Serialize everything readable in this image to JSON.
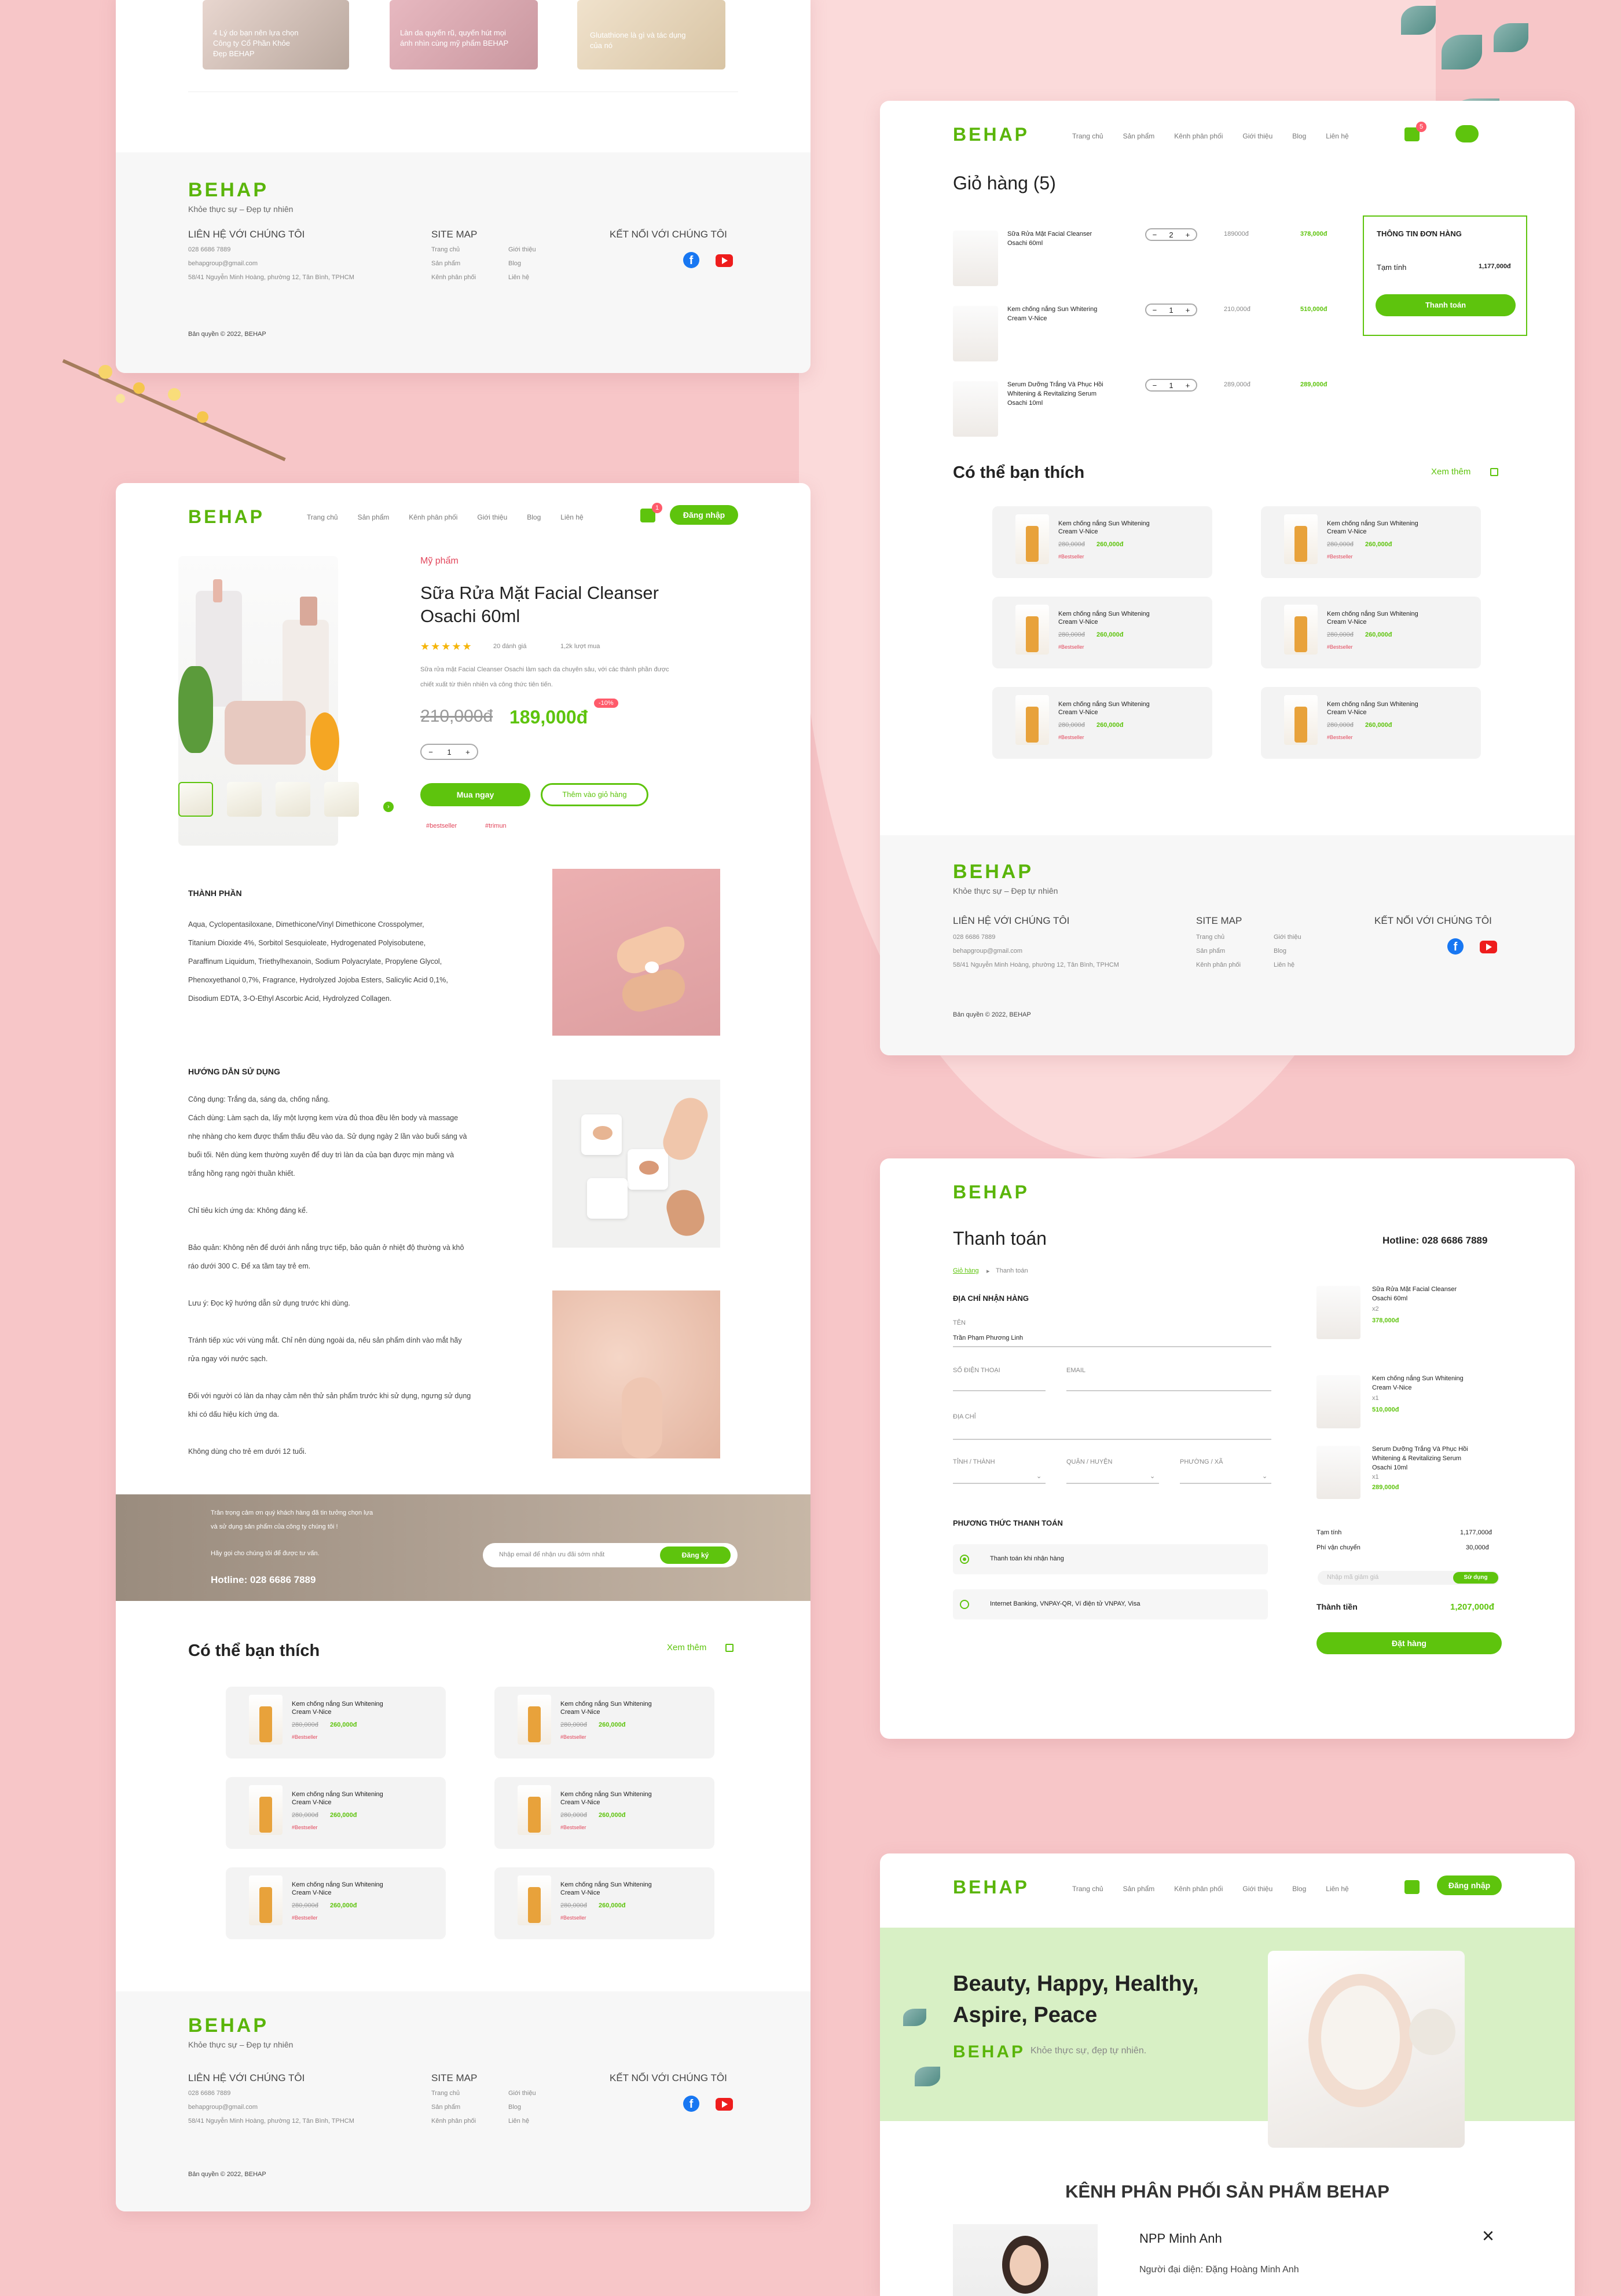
{
  "brand": {
    "logo": "BEHAP",
    "tagline": "Khỏe thực sự – Đẹp tự nhiên",
    "accent": "#5ec40d",
    "pink_bg": "#f7c6c8"
  },
  "nav": [
    "Trang chủ",
    "Sản phẩm",
    "Kênh phân phối",
    "Giới thiệu",
    "Blog",
    "Liên hệ"
  ],
  "login_label": "Đăng nhập",
  "cart_count": "1",
  "cart_count_cart": "5",
  "blog_cards": [
    {
      "title": "4 Lý do bạn nên lựa chọn Công ty Cổ Phần Khỏe Đẹp BEHAP"
    },
    {
      "title": "Làn da quyến rũ, quyến hút mọi ánh nhìn cùng mỹ phẩm BEHAP"
    },
    {
      "title": "Glutathione là gì và tác dụng của nó"
    }
  ],
  "footer": {
    "contact_title": "LIÊN HỆ VỚI CHÚNG TÔI",
    "phone": "028 6686 7889",
    "email": "behapgroup@gmail.com",
    "address": "58/41 Nguyễn Minh Hoàng, phường 12, Tân Bình, TPHCM",
    "sitemap_title": "SITE MAP",
    "sitemap_col1": [
      "Trang chủ",
      "Sản phẩm",
      "Kênh phân phối"
    ],
    "sitemap_col2": [
      "Giới thiệu",
      "Blog",
      "Liên hệ"
    ],
    "social_title": "KẾT NỐI VỚI CHÚNG TÔI",
    "copyright": "Bản quyền © 2022, BEHAP"
  },
  "product": {
    "category": "Mỹ phẩm",
    "name_line1": "Sữa Rửa Mặt Facial Cleanser",
    "name_line2": "Osachi 60ml",
    "rating": 4.5,
    "reviews": "20 đánh giá",
    "sold": "1,2k lượt mua",
    "desc_line1": "Sữa rửa mặt Facial Cleanser Osachi làm sạch da chuyên sâu, với các thành phần được",
    "desc_line2": "chiết xuất từ thiên nhiên và công thức tiên tiến.",
    "old_price": "210,000đ",
    "price": "189,000đ",
    "discount": "-10%",
    "qty": "1",
    "buy_now": "Mua ngay",
    "add_cart": "Thêm vào giỏ hàng",
    "tags": [
      "#bestseller",
      "#trimun"
    ]
  },
  "ingredients": {
    "title": "THÀNH PHẦN",
    "lines": [
      "Aqua, Cyclopentasiloxane, Dimethicone/Vinyl Dimethicone Crosspolymer,",
      "Titanium Dioxide 4%, Sorbitol Sesquioleate, Hydrogenated Polyisobutene,",
      "Paraffinum Liquidum, Triethylhexanoin, Sodium Polyacrylate, Propylene Glycol,",
      "Phenoxyethanol 0,7%, Fragrance, Hydrolyzed Jojoba Esters, Salicylic Acid 0,1%,",
      "Disodium EDTA, 3-O-Ethyl Ascorbic Acid, Hydrolyzed Collagen."
    ]
  },
  "usage": {
    "title": "HƯỚNG DẪN SỬ DỤNG",
    "lines": [
      "Công dụng: Trắng da, sáng da, chống nắng.",
      "Cách dùng: Làm sạch da, lấy một lượng kem vừa đủ thoa đều lên body và massage",
      "nhẹ nhàng cho kem được thẩm thấu đều vào da. Sử dụng ngày 2 lần vào buổi sáng và",
      "buổi tối. Nên dùng kem thường xuyên để duy trì làn da của bạn được mịn màng và",
      "trắng hồng rạng ngời thuần khiết.",
      "",
      "Chỉ tiêu kích ứng da: Không đáng kể.",
      "",
      "Bảo quản: Không nên để dưới ánh nắng trực tiếp, bảo quản ở nhiệt độ thường và khô",
      "ráo dưới 300 C. Để xa tầm tay trẻ em.",
      "",
      "Lưu ý: Đọc kỹ hướng dẫn sử dụng trước khi dùng.",
      "",
      "Tránh tiếp xúc với vùng mắt. Chỉ nên dùng ngoài da, nếu sản phẩm dính vào mắt hãy",
      "rửa ngay với nước sạch.",
      "",
      "Đối với người có làn da nhạy cảm nên thử sản phẩm trước khi sử dụng, ngưng sử dụng",
      "khi có dấu hiệu kích ứng da.",
      "",
      "Không dùng cho trẻ em dưới 12 tuổi."
    ]
  },
  "newsletter": {
    "line1": "Trân trọng cảm ơn quý khách hàng đã tin tưởng chọn lựa",
    "line2": "và sử dụng sản phẩm của công ty chúng tôi !",
    "line3": "Hãy gọi cho chúng tôi để được tư vấn.",
    "hotline": "Hotline: 028 6686 7889",
    "placeholder": "Nhập email để nhận ưu đãi sớm nhất",
    "submit": "Đăng ký"
  },
  "suggest": {
    "title": "Có thể bạn thích",
    "more": "Xem thêm",
    "item_name1": "Kem chống nắng Sun Whitening",
    "item_name2": "Cream V-Nice",
    "old": "280,000đ",
    "price": "260,000đ",
    "tag": "#Bestseller"
  },
  "cart": {
    "title": "Giỏ hàng (5)",
    "items": [
      {
        "name1": "Sữa Rửa Mặt Facial Cleanser",
        "name2": "Osachi 60ml",
        "name3": "",
        "qty": "2",
        "unit": "189000đ",
        "total": "378,000đ"
      },
      {
        "name1": "Kem chống nắng Sun Whitering",
        "name2": "Cream V-Nice",
        "name3": "",
        "qty": "1",
        "unit": "210,000đ",
        "total": "510,000đ"
      },
      {
        "name1": "Serum Dưỡng Trắng Và Phục Hồi",
        "name2": "Whitening & Revitalizing Serum",
        "name3": "Osachi 10ml",
        "qty": "1",
        "unit": "289,000đ",
        "total": "289,000đ"
      }
    ],
    "summary_title": "THÔNG TIN ĐƠN HÀNG",
    "subtotal_label": "Tạm tính",
    "subtotal": "1,177,000đ",
    "checkout": "Thanh toán"
  },
  "checkout": {
    "title": "Thanh toán",
    "hotline": "Hotline: 028 6686 7889",
    "crumb1": "Giỏ hàng",
    "crumb2": "Thanh toán",
    "address_title": "ĐỊA CHỈ NHẬN HÀNG",
    "name_label": "TÊN",
    "name_value": "Trần Phạm Phương Linh",
    "phone_label": "SỐ ĐIỆN THOẠI",
    "email_label": "EMAIL",
    "addr_label": "ĐỊA CHỈ",
    "province": "TỈNH / THÀNH",
    "district": "QUẬN / HUYỆN",
    "ward": "PHƯỜNG / XÃ",
    "pay_title": "PHƯƠNG THỨC THANH TOÁN",
    "pay1": "Thanh toán khi nhận hàng",
    "pay2": "Internet Banking, VNPAY-QR, Ví điện tử VNPAY, Visa",
    "items": [
      {
        "name1": "Sữa Rửa Mặt Facial Cleanser",
        "name2": "Osachi 60ml",
        "qty": "x2",
        "price": "378,000đ"
      },
      {
        "name1": "Kem chống nắng Sun Whitening",
        "name2": "Cream V-Nice",
        "qty": "x1",
        "price": "510,000đ"
      },
      {
        "name1": "Serum Dưỡng Trắng Và Phục Hồi",
        "name2": "Whitening & Revitalizing Serum",
        "name3": "Osachi 10ml",
        "qty": "x1",
        "price": "289,000đ"
      }
    ],
    "subtotal_label": "Tạm tính",
    "subtotal": "1,177,000đ",
    "ship_label": "Phí vận chuyển",
    "ship": "30,000đ",
    "coupon_placeholder": "Nhập mã giảm giá",
    "coupon_btn": "Sử dụng",
    "total_label": "Thành tiền",
    "total": "1,207,000đ",
    "order": "Đặt hàng"
  },
  "distrib": {
    "hero1": "Beauty, Happy, Healthy,",
    "hero2": "Aspire, Peace",
    "hero_tag": "Khỏe thực sự, đẹp tự nhiên.",
    "section_title": "KÊNH PHÂN PHỐI SẢN PHẨM BEHAP",
    "npp": "NPP Minh Anh",
    "rep": "Người đại diện: Đặng Hoàng Minh Anh"
  }
}
